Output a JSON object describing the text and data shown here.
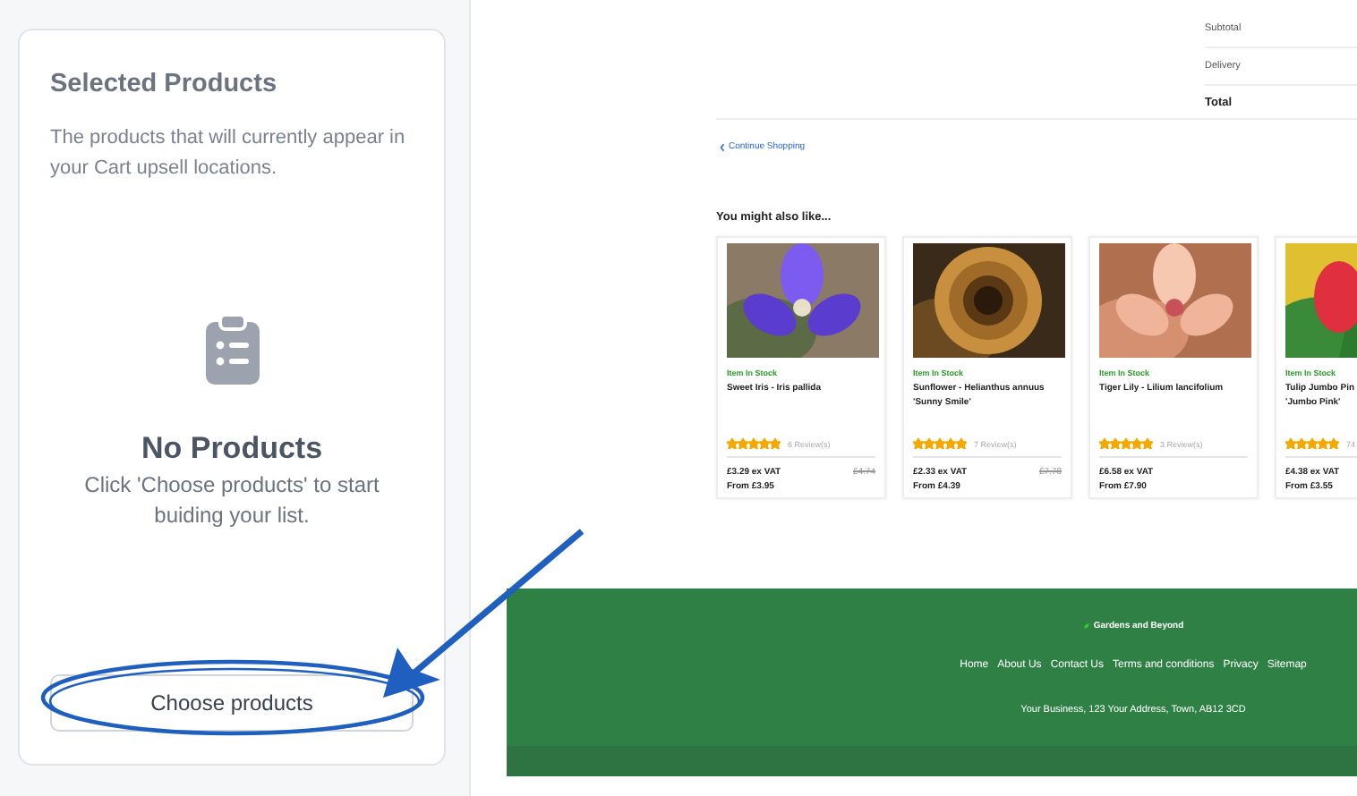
{
  "panel": {
    "title": "Selected Products",
    "description": "The products that will currently appear in your Cart upsell locations.",
    "empty_title": "No Products",
    "empty_text": "Click 'Choose products' to start buiding your list.",
    "button": "Choose products"
  },
  "preview": {
    "summary": [
      {
        "label": "Subtotal",
        "kind": "plain"
      },
      {
        "label": "Delivery",
        "kind": "plain"
      },
      {
        "label": "Total",
        "kind": "total"
      }
    ],
    "continue_link": "Continue Shopping",
    "heading": "You might also like...",
    "products": [
      {
        "kind": "picture",
        "stock": "Item In Stock",
        "name": "Sweet Iris - Iris pallida",
        "stars": 5,
        "reviews": "6 Review(s)",
        "price": "£3.29 ex VAT",
        "old_price": "£4.74",
        "from": "From £3.95"
      },
      {
        "kind": "picture",
        "stock": "Item In Stock",
        "name": "Sunflower - Helianthus annuus 'Sunny Smile'",
        "stars": 5,
        "reviews": "7 Review(s)",
        "price": "£2.33 ex VAT",
        "old_price": "£7.78",
        "from": "From £4.39"
      },
      {
        "kind": "picture",
        "stock": "Item In Stock",
        "name": "Tiger Lily - Lilium lancifolium",
        "stars": 5,
        "reviews": "3 Review(s)",
        "price": "£6.58 ex VAT",
        "from": "From £7.90"
      },
      {
        "kind": "picture",
        "stock": "Item In Stock",
        "name": "Tulip Jumbo Pin\n'Jumbo Pink'",
        "stars": 5,
        "reviews": "74",
        "price": "£4.38 ex VAT",
        "from": "From £3.55"
      }
    ],
    "footer": {
      "brand": "Gardens and Beyond",
      "links": [
        "Home",
        "About Us",
        "Contact Us",
        "Terms and conditions",
        "Privacy",
        "Sitemap"
      ],
      "address": "Your Business, 123 Your Address, Town, AB12 3CD"
    }
  }
}
